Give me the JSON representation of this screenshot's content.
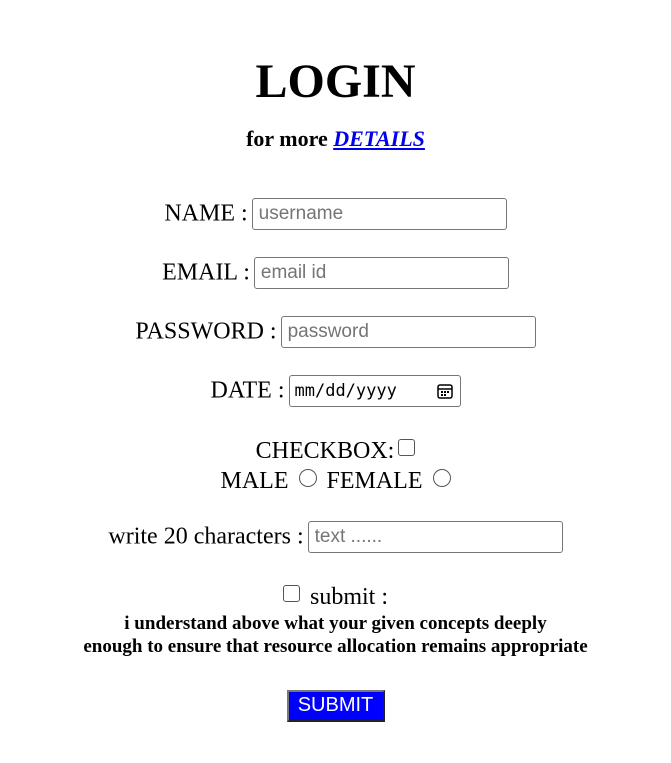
{
  "header": {
    "title": "LOGIN",
    "subtitle_prefix": "for more ",
    "subtitle_link": "DETAILS"
  },
  "form": {
    "name": {
      "label": "NAME :",
      "placeholder": "username",
      "value": ""
    },
    "email": {
      "label": "EMAIL :",
      "placeholder": "email id",
      "value": ""
    },
    "password": {
      "label": "PASSWORD :",
      "placeholder": "password",
      "value": ""
    },
    "date": {
      "label": "DATE :",
      "placeholder": "mm/dd/yyyy"
    },
    "checkbox": {
      "label": "CHECKBOX:",
      "checked": false
    },
    "gender": {
      "male_label": "MALE",
      "female_label": "FEMALE"
    },
    "chars": {
      "label": "write 20 characters :",
      "placeholder": "text ......",
      "value": ""
    },
    "agree": {
      "label": "submit :",
      "checked": false
    },
    "note_line1": "i understand above what your given concepts deeply",
    "note_line2": "enough to ensure that resource allocation remains appropriate",
    "submit_label": "SUBMIT"
  },
  "colors": {
    "link": "#0000ee",
    "submit_bg": "#0000ff",
    "submit_text": "#ffffff"
  },
  "icons": {
    "date_picker": "calendar-icon"
  }
}
